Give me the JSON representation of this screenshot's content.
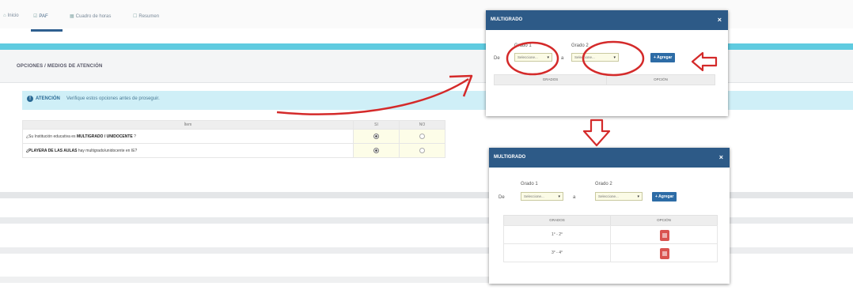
{
  "nav": {
    "tabs": [
      {
        "label": "Inicio",
        "icon": "home-icon"
      },
      {
        "label": "PAF",
        "icon": "clipboard-icon"
      },
      {
        "label": "Cuadro de horas",
        "icon": "grid-icon"
      },
      {
        "label": "Resumen",
        "icon": "document-icon"
      }
    ]
  },
  "section": {
    "title": "OPCIONES / MEDIOS DE ATENCIÓN"
  },
  "alert": {
    "strong": "ATENCIÓN",
    "text": "Verifique estos opciones antes de proseguir."
  },
  "table": {
    "headers": [
      "Ítem",
      "SI",
      "NO"
    ],
    "rows": [
      {
        "prefix": "¿Su Institución educativa es ",
        "bold": "MULTIGRADO / UNIDOCENTE",
        "suffix": " ?",
        "selected": "SI"
      },
      {
        "prefix": "",
        "bold": "¿PLAYERA DE LAS AULAS",
        "suffix": " hay multigrado/unidocente en IE?",
        "selected": "SI"
      }
    ]
  },
  "modal1": {
    "title": "MULTIGRADO",
    "de": "De",
    "grado1_label": "Grado 1",
    "grado2_label": "Grado 2",
    "select_placeholder": "Seleccione...",
    "a": "a",
    "add_label": "+ Agregar",
    "col_grados": "GRADOS",
    "col_opcion": "OPCIÓN"
  },
  "modal2": {
    "title": "MULTIGRADO",
    "de": "De",
    "grado1_label": "Grado 1",
    "grado2_label": "Grado 2",
    "select_placeholder": "Seleccione...",
    "a": "a",
    "add_label": "+ Agregar",
    "col_grados": "GRADOS",
    "col_opcion": "OPCIÓN",
    "rows": [
      {
        "grados": "1° - 2°"
      },
      {
        "grados": "3° - 4°"
      }
    ]
  },
  "colors": {
    "header": "#2d5a87",
    "accent_cyan": "#5fcbe0",
    "annotation_red": "#d42a2a",
    "delete_red": "#d9534f"
  }
}
